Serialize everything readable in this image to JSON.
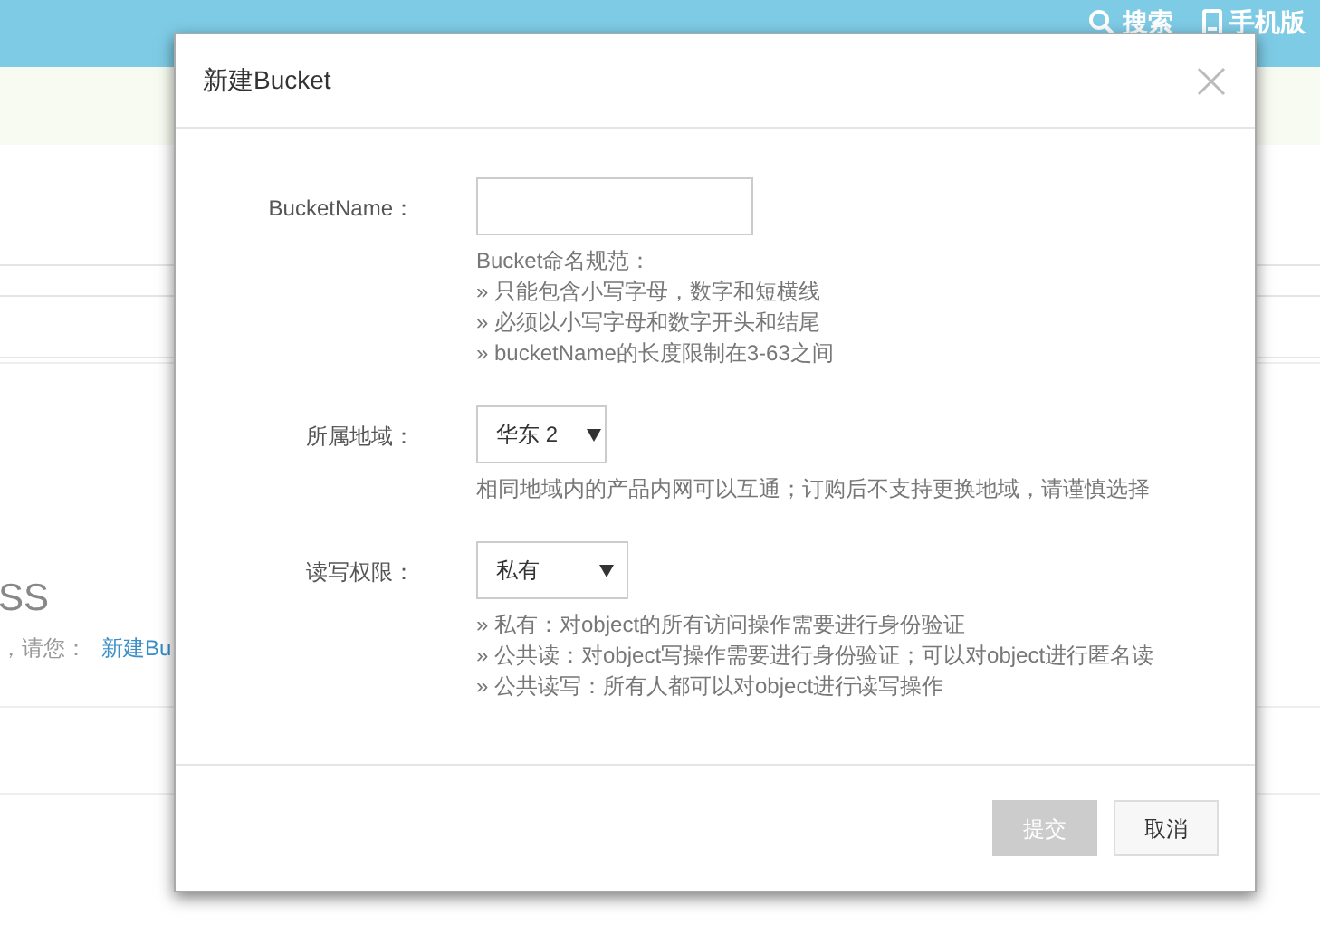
{
  "top_bar": {
    "links": [
      {
        "label": "搜索"
      },
      {
        "label": "手机版"
      }
    ]
  },
  "background": {
    "heading": "SS",
    "prompt": "，请您：",
    "link": "新建Bu"
  },
  "dialog": {
    "title": "新建Bucket",
    "fields": [
      {
        "kind": "input",
        "label": "BucketName：",
        "hints": [
          "Bucket命名规范：",
          "» 只能包含小写字母，数字和短横线",
          "» 必须以小写字母和数字开头和结尾",
          "» bucketName的长度限制在3-63之间"
        ]
      },
      {
        "kind": "select",
        "label": "所属地域：",
        "value": "华东 2",
        "hints": [
          "相同地域内的产品内网可以互通；订购后不支持更换地域，请谨慎选择"
        ]
      },
      {
        "kind": "select",
        "label": "读写权限：",
        "value": "私有",
        "hints": [
          "» 私有：对object的所有访问操作需要进行身份验证",
          "» 公共读：对object写操作需要进行身份验证；可以对object进行匿名读",
          "» 公共读写：所有人都可以对object进行读写操作"
        ]
      }
    ],
    "buttons": [
      {
        "label": "提交",
        "disabled": true
      },
      {
        "label": "取消",
        "disabled": false
      }
    ]
  }
}
